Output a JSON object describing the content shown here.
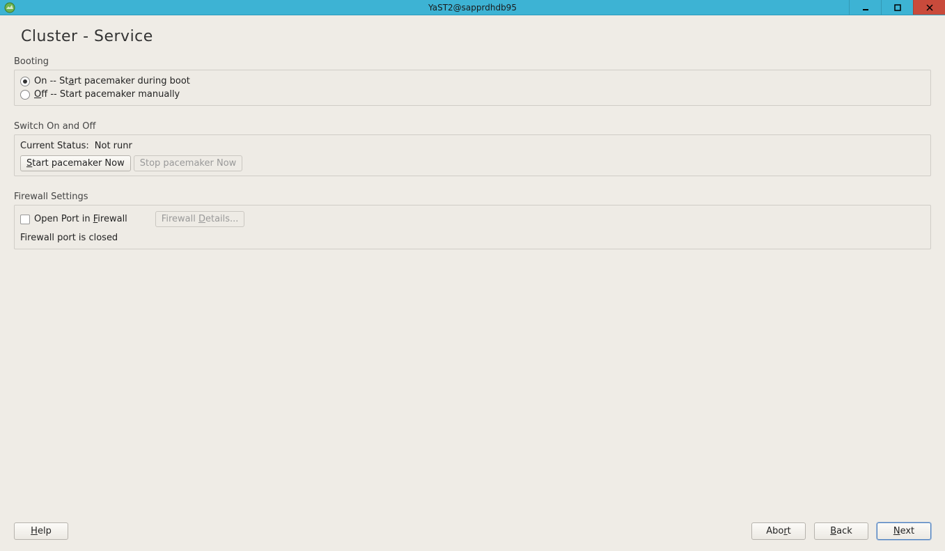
{
  "window": {
    "title": "YaST2@sapprdhdb95"
  },
  "page": {
    "title": "Cluster - Service"
  },
  "booting": {
    "section_label": "Booting",
    "option_on_pre": "On -- St",
    "option_on_ul": "a",
    "option_on_post": "rt pacemaker during boot",
    "option_off_ul": "O",
    "option_off_post": "ff -- Start pacemaker manually"
  },
  "switch": {
    "section_label": "Switch On and Off",
    "status_label": "Current Status:",
    "status_value": "Not runr",
    "start_btn_ul": "S",
    "start_btn_post": "tart pacemaker Now",
    "stop_btn": "Stop pacemaker Now"
  },
  "firewall": {
    "section_label": "Firewall Settings",
    "open_port_pre": "Open Port in ",
    "open_port_ul": "F",
    "open_port_post": "irewall",
    "details_btn_pre": "Firewall ",
    "details_btn_ul": "D",
    "details_btn_post": "etails...",
    "status_text": "Firewall port is closed"
  },
  "footer": {
    "help_ul": "H",
    "help_post": "elp",
    "abort_pre": "Abo",
    "abort_ul": "r",
    "abort_post": "t",
    "back_ul": "B",
    "back_post": "ack",
    "next_ul": "N",
    "next_post": "ext"
  }
}
